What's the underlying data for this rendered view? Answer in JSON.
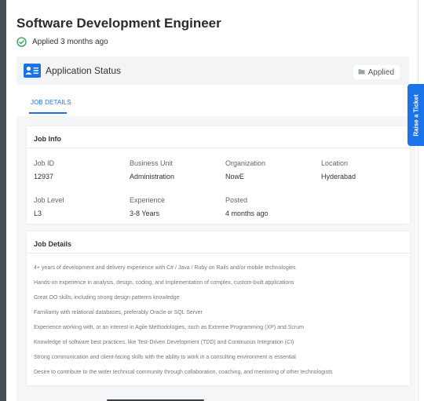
{
  "job": {
    "title": "Software Development Engineer",
    "applied_text": "Applied 3 months ago"
  },
  "status": {
    "title": "Application Status",
    "badge": "Applied"
  },
  "tabs": [
    {
      "label": "JOB DETAILS",
      "active": true
    }
  ],
  "job_info": {
    "heading": "Job Info",
    "fields": [
      {
        "label": "Job ID",
        "value": "12937"
      },
      {
        "label": "Business Unit",
        "value": "Administration"
      },
      {
        "label": "Organization",
        "value": "NowE"
      },
      {
        "label": "Location",
        "value": "Hyderabad"
      },
      {
        "label": "Job Level",
        "value": "L3"
      },
      {
        "label": "Experience",
        "value": "3-8 Years"
      },
      {
        "label": "Posted",
        "value": "4 months ago"
      }
    ]
  },
  "job_details": {
    "heading": "Job Details",
    "lines": [
      "4+ years of development and delivery experience with C# / Java / Ruby on Rails and/or mobile technologies",
      "Hands-on experience in analysis, design, coding, and implementation of complex, custom-built applications",
      "Great OO skills, including strong design patterns knowledge",
      "Familiarity with relational databases, preferably Oracle or SQL Server",
      "Experience working with, or an interest in Agile Methodologies, such as Extreme Programming (XP) and Scrum",
      "Knowledge of software best practices, like Test-Driven Development (TDD) and Continuous Integration (CI)",
      "Strong communication and client-facing skills with the ability to work in a consulting environment is essential",
      "Desire to contribute to the wider technical community through collaboration, coaching, and mentoring of other technologists"
    ]
  },
  "side_tab": {
    "label": "Raise a Ticket"
  },
  "colors": {
    "accent": "#1a73e8",
    "success": "#2e9e4f",
    "sidebar": "#4a4f56"
  },
  "icons": {
    "applied": "check-circle-icon",
    "status": "contact-card-icon",
    "badge": "folder-icon"
  }
}
